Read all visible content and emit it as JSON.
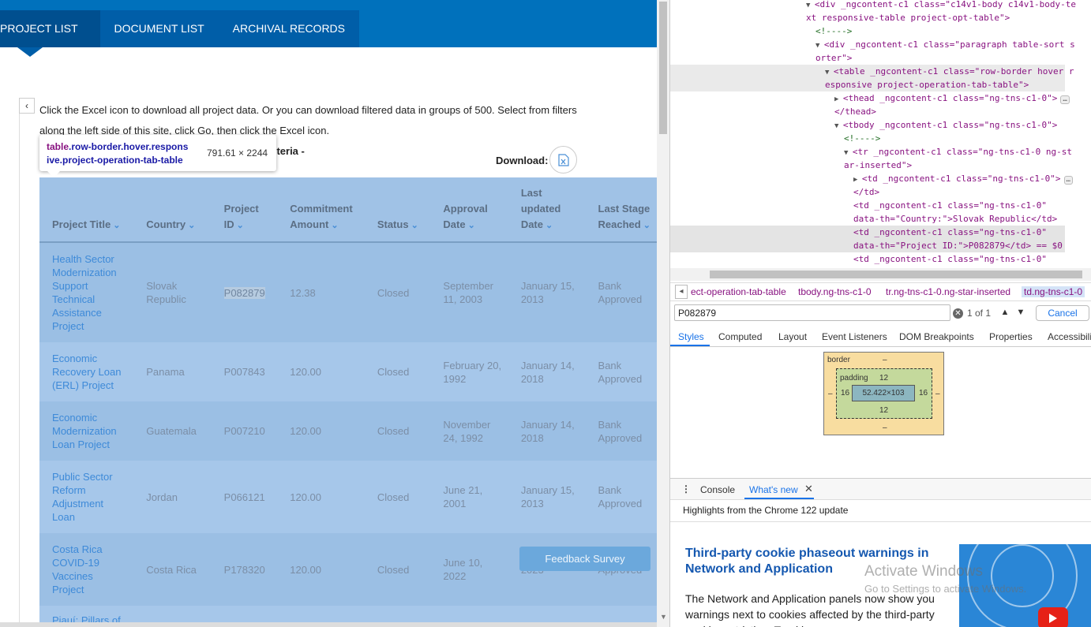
{
  "page": {
    "tabs": [
      "PROJECT LIST",
      "DOCUMENT LIST",
      "ARCHIVAL RECORDS"
    ],
    "collapse_icon": "‹",
    "info_line1": "Click the Excel icon to download all project data. Or you can download filtered data in groups of 500. Select from filters",
    "info_line2": "along the left side of this site, click Go, then click the Excel icon.",
    "criteria_text": "h criteria -",
    "download_label": "Download:",
    "tooltip": {
      "selector_tag": "table",
      "selector_classes": ".row-border.hover.respons",
      "selector_classes2": "ive.project-operation-tab-table",
      "dimensions": "791.61 × 2244"
    },
    "table": {
      "headers": [
        {
          "l1": "",
          "l2": "",
          "l3": "Project Title"
        },
        {
          "l1": "",
          "l2": "",
          "l3": "Country"
        },
        {
          "l1": "",
          "l2": "Project",
          "l3": "ID"
        },
        {
          "l1": "",
          "l2": "Commitment",
          "l3": "Amount"
        },
        {
          "l1": "",
          "l2": "",
          "l3": "Status"
        },
        {
          "l1": "",
          "l2": "Approval",
          "l3": "Date"
        },
        {
          "l1": "Last",
          "l2": "updated",
          "l3": "Date"
        },
        {
          "l1": "",
          "l2": "Last Stage",
          "l3": "Reached"
        }
      ],
      "rows": [
        {
          "title": "Health Sector Modernization Support Technical Assistance Project",
          "country": "Slovak Republic",
          "id": "P082879",
          "amount": "12.38",
          "status": "Closed",
          "approval": "September 11, 2003",
          "updated": "January 15, 2013",
          "stage": "Bank Approved"
        },
        {
          "title": "Economic Recovery Loan (ERL) Project",
          "country": "Panama",
          "id": "P007843",
          "amount": "120.00",
          "status": "Closed",
          "approval": "February 20, 1992",
          "updated": "January 14, 2018",
          "stage": "Bank Approved"
        },
        {
          "title": "Economic Modernization Loan Project",
          "country": "Guatemala",
          "id": "P007210",
          "amount": "120.00",
          "status": "Closed",
          "approval": "November 24, 1992",
          "updated": "January 14, 2018",
          "stage": "Bank Approved"
        },
        {
          "title": "Public Sector Reform Adjustment Loan",
          "country": "Jordan",
          "id": "P066121",
          "amount": "120.00",
          "status": "Closed",
          "approval": "June 21, 2001",
          "updated": "January 15, 2013",
          "stage": "Bank Approved"
        },
        {
          "title": "Costa Rica COVID-19 Vaccines Project",
          "country": "Costa Rica",
          "id": "P178320",
          "amount": "120.00",
          "status": "Closed",
          "approval": "June 10, 2022",
          "updated": "2023",
          "stage": "Approved"
        }
      ],
      "partial_row_title": "Piauí: Pillars of"
    },
    "feedback_button": "Feedback Survey"
  },
  "devtools": {
    "dom_lines": [
      {
        "k": "open",
        "t": "<div _ngcontent-c1 class=\"c14v1-body c14v1-body-te"
      },
      {
        "k": "cont",
        "t": "xt responsive-table project-opt-table\">"
      },
      {
        "k": "comment",
        "t": "<!---->"
      },
      {
        "k": "open",
        "t": "<div _ngcontent-c1 class=\"paragraph table-sort s"
      },
      {
        "k": "cont",
        "t": "orter\">"
      },
      {
        "k": "open",
        "t": "<table _ngcontent-c1 class=\"row-border hover r"
      },
      {
        "k": "cont",
        "t": "esponsive project-operation-tab-table\">"
      },
      {
        "k": "closed",
        "t": "<thead _ngcontent-c1 class=\"ng-tns-c1-0\">"
      },
      {
        "k": "close",
        "t": "</thead>"
      },
      {
        "k": "open",
        "t": "<tbody _ngcontent-c1 class=\"ng-tns-c1-0\">"
      },
      {
        "k": "comment",
        "t": "<!---->"
      },
      {
        "k": "open",
        "t": "<tr _ngcontent-c1 class=\"ng-tns-c1-0 ng-st"
      },
      {
        "k": "cont",
        "t": "ar-inserted\">"
      },
      {
        "k": "closed",
        "t": "<td _ngcontent-c1 class=\"ng-tns-c1-0\">"
      },
      {
        "k": "close",
        "t": "</td>"
      },
      {
        "k": "plain",
        "t": "<td _ngcontent-c1 class=\"ng-tns-c1-0\""
      },
      {
        "k": "cont",
        "t": "data-th=\"Country:\">Slovak Republic</td>"
      },
      {
        "k": "plain",
        "t": "<td _ngcontent-c1 class=\"ng-tns-c1-0\""
      },
      {
        "k": "sel",
        "t": "data-th=\"Project ID:\">P082879</td> == $0"
      },
      {
        "k": "plain",
        "t": "<td _ngcontent-c1 class=\"ng-tns-c1-0\""
      },
      {
        "k": "cont",
        "t": "data-th=\"Commitment Amount:\">12.38</td>"
      }
    ],
    "breadcrumbs": [
      "ect-operation-tab-table",
      "tbody.ng-tns-c1-0",
      "tr.ng-tns-c1-0.ng-star-inserted",
      "td.ng-tns-c1-0"
    ],
    "search": {
      "value": "P082879",
      "count": "1 of 1",
      "cancel": "Cancel"
    },
    "subtabs": [
      "Styles",
      "Computed",
      "Layout",
      "Event Listeners",
      "DOM Breakpoints",
      "Properties",
      "Accessibility"
    ],
    "box_model": {
      "border_label": "border",
      "border_value": "–",
      "padding_label": "padding",
      "padding_top": "12",
      "padding_bottom": "12",
      "padding_left": "16",
      "padding_right": "16",
      "content": "52.422×103",
      "margin_left": "–",
      "margin_right": "–",
      "border_bottom": "–"
    },
    "drawer": {
      "tabs": [
        "Console",
        "What's new"
      ],
      "close": "✕"
    },
    "highlights": "Highlights from the Chrome 122 update",
    "whats_new_title": "Third-party cookie phaseout warnings in Network and Application",
    "whats_new_body": "The Network and Application panels now show you warnings next to cookies affected by the third-party cookie restriction. Tracking"
  },
  "windows_watermark": {
    "line1": "Activate Windows",
    "line2": "Go to Settings to activate Windows."
  },
  "colors": {
    "brand_blue": "#0071bc",
    "tab_dark": "#004f8f",
    "inspect_overlay": "#a0c2e6",
    "link_blue": "#1a73e8"
  }
}
